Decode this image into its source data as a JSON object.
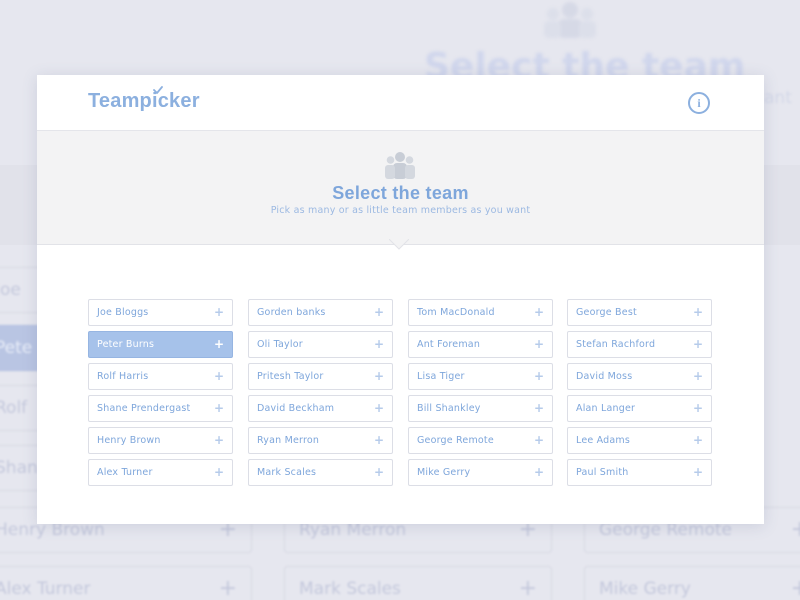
{
  "app": {
    "logo_text": "Teampicker",
    "info_icon": "info-icon",
    "accent_color": "#7ea6db"
  },
  "hero": {
    "icon": "team-people-icon",
    "title": "Select the team",
    "subtitle": "Pick as many or as little team members as you want"
  },
  "background": {
    "title": "Select the team",
    "subtitle": "ant",
    "cells": [
      {
        "label": "Joe",
        "selected": false
      },
      {
        "label": "Pete",
        "selected": true
      },
      {
        "label": "Rolf",
        "selected": false
      },
      {
        "label": "Shan",
        "selected": false
      },
      {
        "label": "Henry Brown",
        "selected": false
      },
      {
        "label": "Alex Turner",
        "selected": false
      },
      {
        "label": "Ryan Merron",
        "selected": false
      },
      {
        "label": "Mark Scales",
        "selected": false
      },
      {
        "label": "George Remote",
        "selected": false
      },
      {
        "label": "Mike Gerry",
        "selected": false
      }
    ]
  },
  "team": {
    "add_symbol": "+",
    "selected_color": "#a6c2ea",
    "columns": [
      [
        {
          "name": "Joe Bloggs",
          "selected": false
        },
        {
          "name": "Peter Burns",
          "selected": true
        },
        {
          "name": "Rolf Harris",
          "selected": false
        },
        {
          "name": "Shane Prendergast",
          "selected": false
        },
        {
          "name": "Henry Brown",
          "selected": false
        },
        {
          "name": "Alex Turner",
          "selected": false
        }
      ],
      [
        {
          "name": "Gorden banks",
          "selected": false
        },
        {
          "name": "Oli Taylor",
          "selected": false
        },
        {
          "name": "Pritesh Taylor",
          "selected": false
        },
        {
          "name": "David Beckham",
          "selected": false
        },
        {
          "name": "Ryan Merron",
          "selected": false
        },
        {
          "name": "Mark Scales",
          "selected": false
        }
      ],
      [
        {
          "name": "Tom MacDonald",
          "selected": false
        },
        {
          "name": "Ant Foreman",
          "selected": false
        },
        {
          "name": "Lisa Tiger",
          "selected": false
        },
        {
          "name": "Bill Shankley",
          "selected": false
        },
        {
          "name": "George Remote",
          "selected": false
        },
        {
          "name": "Mike Gerry",
          "selected": false
        }
      ],
      [
        {
          "name": "George Best",
          "selected": false
        },
        {
          "name": "Stefan Rachford",
          "selected": false
        },
        {
          "name": "David Moss",
          "selected": false
        },
        {
          "name": "Alan Langer",
          "selected": false
        },
        {
          "name": "Lee Adams",
          "selected": false
        },
        {
          "name": "Paul Smith",
          "selected": false
        }
      ]
    ]
  }
}
